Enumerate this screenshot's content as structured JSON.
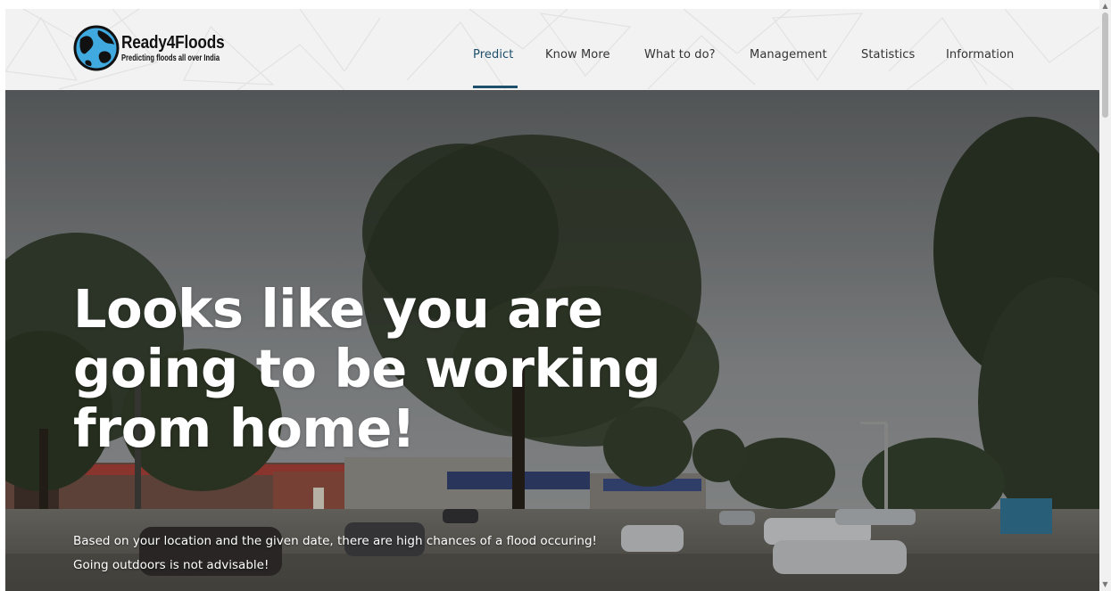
{
  "brand": {
    "name": "Ready4Floods",
    "tagline": "Predicting floods all over India",
    "logo_icon": "globe-icon"
  },
  "nav": {
    "items": [
      {
        "label": "Predict",
        "active": true
      },
      {
        "label": "Know More",
        "active": false
      },
      {
        "label": "What to do?",
        "active": false
      },
      {
        "label": "Management",
        "active": false
      },
      {
        "label": "Statistics",
        "active": false
      },
      {
        "label": "Information",
        "active": false
      }
    ]
  },
  "hero": {
    "title": "Looks like you are going to be working from home!",
    "message_line1": "Based on your location and the given date, there are high chances of a flood occuring!",
    "message_line2": "Going outdoors is not advisable!",
    "background": "flooded-street-image"
  },
  "colors": {
    "accent": "#1d4f6b",
    "header_bg": "#f2f2f2",
    "hero_text": "#ffffff"
  }
}
